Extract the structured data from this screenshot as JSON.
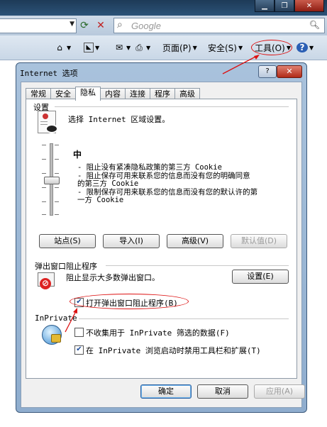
{
  "browser": {
    "window_controls": {
      "minimize": "▁",
      "maximize": "❐",
      "close": "✕"
    },
    "search_placeholder": "Google",
    "commands": {
      "home_icon": "home-icon",
      "feeds_icon": "feeds-icon",
      "mail_icon": "mail-icon",
      "print_icon": "print-icon",
      "page_label": "页面(P)",
      "safety_label": "安全(S)",
      "tools_label": "工具(O)",
      "help_icon": "help-icon"
    }
  },
  "dialog": {
    "title": "Internet 选项",
    "help_glyph": "?",
    "close_glyph": "✕",
    "tabs": [
      {
        "label": "常规",
        "active": false
      },
      {
        "label": "安全",
        "active": false
      },
      {
        "label": "隐私",
        "active": true
      },
      {
        "label": "内容",
        "active": false
      },
      {
        "label": "连接",
        "active": false
      },
      {
        "label": "程序",
        "active": false
      },
      {
        "label": "高级",
        "active": false
      }
    ],
    "settings": {
      "heading": "设置",
      "zone_instruction": "选择 Internet 区域设置。",
      "level_name": "中",
      "level_description": "- 阻止没有紧凑隐私政策的第三方 Cookie\n- 阻止保存可用来联系您的信息而没有您的明确同意\n的第三方 Cookie\n- 限制保存可用来联系您的信息而没有您的默认许的第\n一方 Cookie",
      "slider_level": "中",
      "buttons": {
        "sites": "站点(S)",
        "import": "导入(I)",
        "advanced": "高级(V)",
        "default": "默认值(D)"
      }
    },
    "popup": {
      "heading": "弹出窗口阻止程序",
      "description": "阻止显示大多数弹出窗口。",
      "settings_button": "设置(E)",
      "enable_label": "打开弹出窗口阻止程序(B)",
      "enable_checked": true
    },
    "inprivate": {
      "heading": "InPrivate",
      "no_collect_label": "不收集用于 InPrivate 筛选的数据(F)",
      "no_collect_checked": false,
      "disable_toolbars_label": "在 InPrivate 浏览启动时禁用工具栏和扩展(T)",
      "disable_toolbars_checked": true
    },
    "footer": {
      "ok": "确定",
      "cancel": "取消",
      "apply": "应用(A)"
    }
  },
  "annotation_color": "#dd1111"
}
